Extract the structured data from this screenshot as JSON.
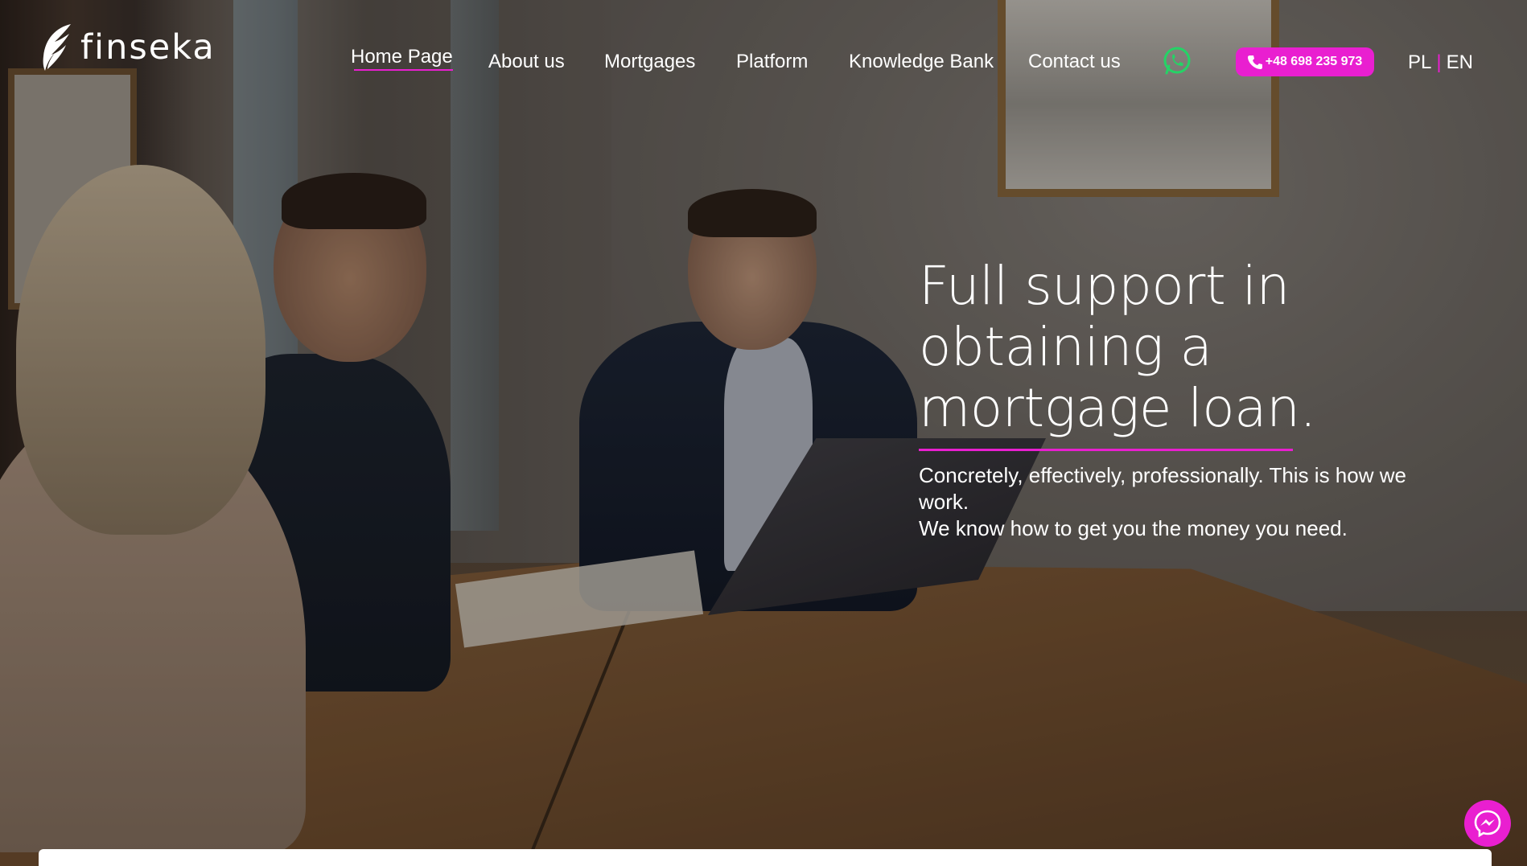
{
  "brand": {
    "name": "finseka"
  },
  "nav": {
    "items": [
      {
        "label": "Home Page",
        "active": true
      },
      {
        "label": "About us"
      },
      {
        "label": "Mortgages"
      },
      {
        "label": "Platform"
      },
      {
        "label": "Knowledge Bank"
      },
      {
        "label": "Contact us"
      }
    ]
  },
  "contact": {
    "phone": "+48 698 235 973",
    "whatsapp_icon": "whatsapp-icon"
  },
  "language": {
    "pl": "PL",
    "separator": "|",
    "en": "EN"
  },
  "hero": {
    "headline": "Full support in obtaining a mortgage loan.",
    "subline1": "Concretely, effectively, professionally. This is how we work.",
    "subline2": "We know how to get you the money you need."
  },
  "colors": {
    "accent": "#e91fd0",
    "text": "#ffffff",
    "whatsapp": "#25d366"
  },
  "icons": {
    "messenger": "messenger-icon",
    "phone": "phone-icon",
    "logo": "feather-logo"
  }
}
